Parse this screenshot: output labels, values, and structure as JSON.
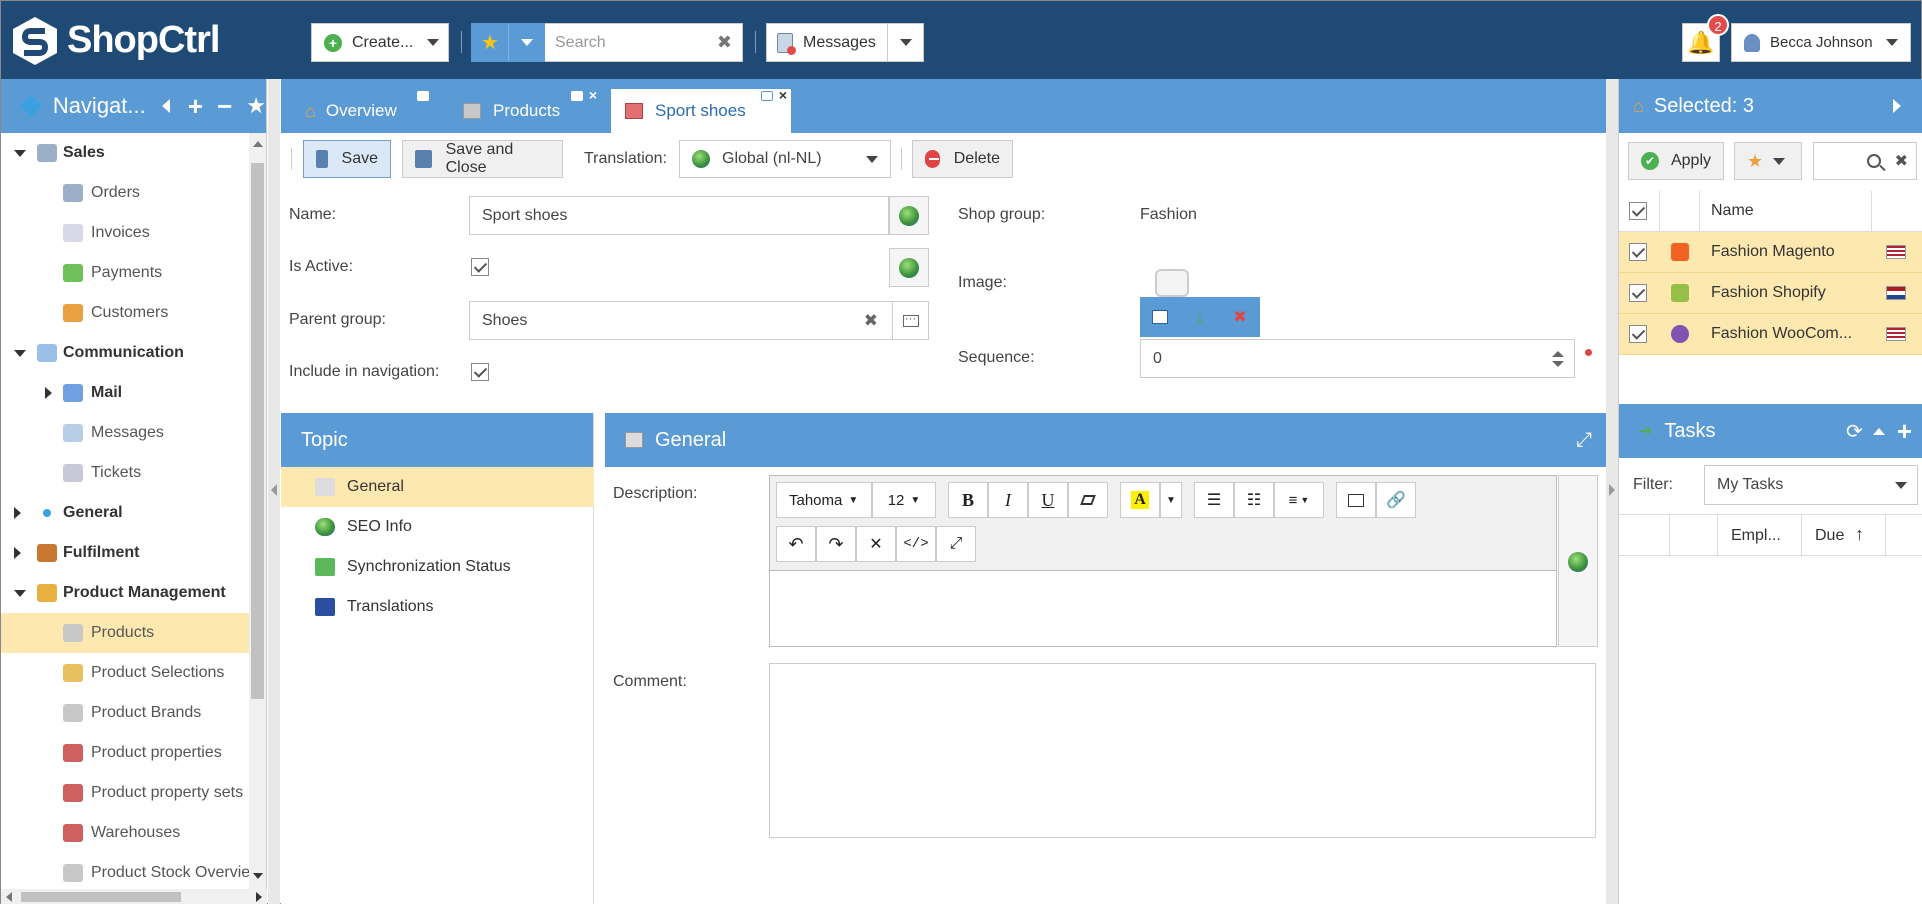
{
  "app": {
    "name": "ShopCtrl"
  },
  "topbar": {
    "create_label": "Create...",
    "search_placeholder": "Search",
    "messages_label": "Messages",
    "notification_count": "2",
    "user_name": "Becca Johnson"
  },
  "nav": {
    "title": "Navigat...",
    "items": [
      {
        "label": "Sales",
        "level": 0,
        "group": true,
        "expanded": true,
        "icon": "sales-icon"
      },
      {
        "label": "Orders",
        "level": 1,
        "icon": "orders-icon"
      },
      {
        "label": "Invoices",
        "level": 1,
        "icon": "invoices-icon"
      },
      {
        "label": "Payments",
        "level": 1,
        "icon": "payments-icon"
      },
      {
        "label": "Customers",
        "level": 1,
        "icon": "customers-icon"
      },
      {
        "label": "Communication",
        "level": 0,
        "group": true,
        "expanded": true,
        "icon": "communication-icon"
      },
      {
        "label": "Mail",
        "level": 1,
        "group": true,
        "expanded": false,
        "icon": "mail-icon"
      },
      {
        "label": "Messages",
        "level": 1,
        "icon": "messages-icon"
      },
      {
        "label": "Tickets",
        "level": 1,
        "icon": "tickets-icon"
      },
      {
        "label": "General",
        "level": 0,
        "group": true,
        "expanded": false,
        "icon": "general-icon"
      },
      {
        "label": "Fulfilment",
        "level": 0,
        "group": true,
        "expanded": false,
        "icon": "fulfilment-icon"
      },
      {
        "label": "Product Management",
        "level": 0,
        "group": true,
        "expanded": true,
        "icon": "product-management-icon"
      },
      {
        "label": "Products",
        "level": 1,
        "selected": true,
        "icon": "products-icon"
      },
      {
        "label": "Product Selections",
        "level": 1,
        "icon": "product-selections-icon"
      },
      {
        "label": "Product Brands",
        "level": 1,
        "icon": "product-brands-icon"
      },
      {
        "label": "Product properties",
        "level": 1,
        "icon": "product-properties-icon"
      },
      {
        "label": "Product property sets",
        "level": 1,
        "icon": "product-property-sets-icon"
      },
      {
        "label": "Warehouses",
        "level": 1,
        "icon": "warehouses-icon"
      },
      {
        "label": "Product Stock Overview",
        "level": 1,
        "icon": "product-stock-icon"
      }
    ]
  },
  "tabs": [
    {
      "label": "Overview",
      "icon": "home-icon"
    },
    {
      "label": "Products",
      "icon": "box-icon"
    },
    {
      "label": "Sport shoes",
      "icon": "box-icon",
      "active": true
    }
  ],
  "toolbar": {
    "save_label": "Save",
    "save_close_label": "Save and Close",
    "translation_label": "Translation:",
    "translation_value": "Global (nl-NL)",
    "delete_label": "Delete"
  },
  "form": {
    "name_label": "Name:",
    "name_value": "Sport shoes",
    "active_label": "Is Active:",
    "parent_label": "Parent group:",
    "parent_value": "Shoes",
    "nav_label": "Include in navigation:",
    "shopgroup_label": "Shop group:",
    "shopgroup_value": "Fashion",
    "image_label": "Image:",
    "sequence_label": "Sequence:",
    "sequence_value": "0"
  },
  "topic": {
    "title": "Topic",
    "items": [
      {
        "label": "General",
        "selected": true,
        "icon": "box-icon"
      },
      {
        "label": "SEO Info",
        "icon": "globe-icon"
      },
      {
        "label": "Synchronization Status",
        "icon": "sync-icon"
      },
      {
        "label": "Translations",
        "icon": "eu-flag-icon"
      }
    ]
  },
  "general": {
    "title": "General",
    "description_label": "Description:",
    "comment_label": "Comment:",
    "font_family": "Tahoma",
    "font_size": "12"
  },
  "selected": {
    "title": "Selected: 3",
    "apply_label": "Apply",
    "name_header": "Name",
    "rows": [
      {
        "name": "Fashion Magento",
        "icon": "magento-icon",
        "flag": "us-flag-icon"
      },
      {
        "name": "Fashion Shopify",
        "icon": "shopify-icon",
        "flag": "nl-flag-icon"
      },
      {
        "name": "Fashion WooCom...",
        "icon": "woocommerce-icon",
        "flag": "us-flag-icon"
      }
    ]
  },
  "tasks": {
    "title": "Tasks",
    "filter_label": "Filter:",
    "filter_value": "My Tasks",
    "col_empl": "Empl...",
    "col_due": "Due"
  },
  "colors": {
    "topbar": "#1f4a75",
    "panel": "#5b9bd5",
    "selection": "#fde9b0"
  }
}
